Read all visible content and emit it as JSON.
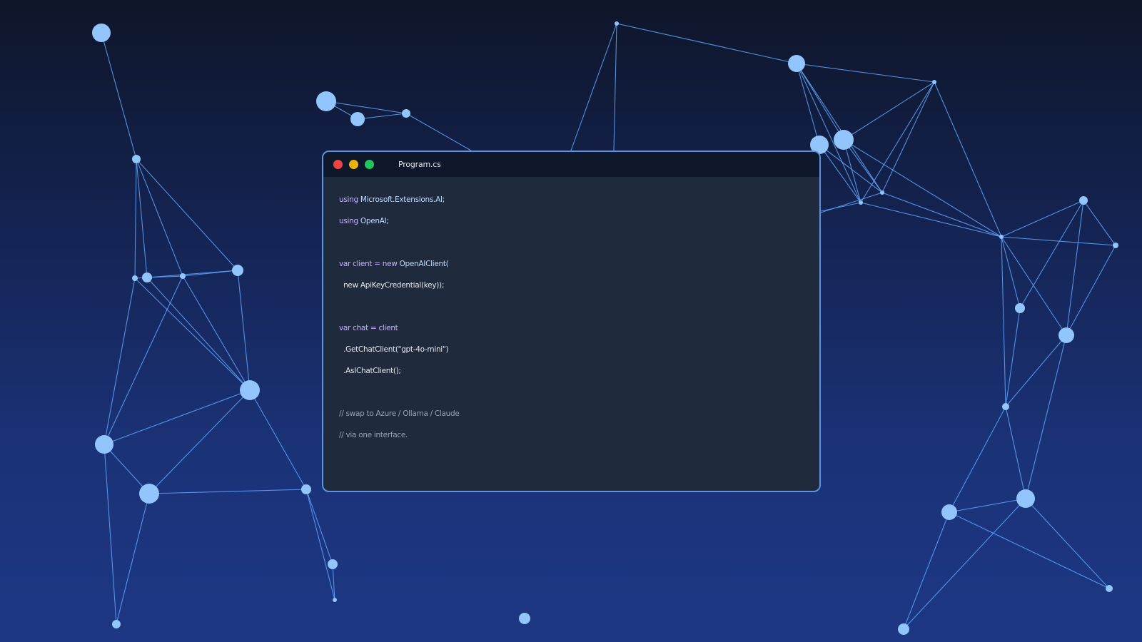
{
  "window": {
    "file_name": "Program.cs"
  },
  "code_lines": [
    [
      {
        "t": "using ",
        "c": "keyword"
      },
      {
        "t": "Microsoft.Extensions.AI;",
        "c": "type"
      }
    ],
    [
      {
        "t": "using ",
        "c": "keyword"
      },
      {
        "t": "OpenAI;",
        "c": "type"
      }
    ],
    [],
    [
      {
        "t": "var ",
        "c": "keyword"
      },
      {
        "t": "client = new ",
        "c": "keyword"
      },
      {
        "t": "OpenAIClient(",
        "c": "type"
      }
    ],
    [
      {
        "t": "  new ApiKeyCredential(key));",
        "c": "plain"
      }
    ],
    [],
    [
      {
        "t": "var ",
        "c": "keyword"
      },
      {
        "t": "chat = client",
        "c": "keyword"
      }
    ],
    [
      {
        "t": "  .GetChatClient(\"gpt-4o-mini\")",
        "c": "plain"
      }
    ],
    [
      {
        "t": "  .AsIChatClient();",
        "c": "plain"
      }
    ],
    [],
    [
      {
        "t": "// swap to Azure / Ollama / Claude",
        "c": "comment"
      }
    ],
    [
      {
        "t": "// via one interface.",
        "c": "comment"
      }
    ]
  ],
  "colors": {
    "node": "#93c5fd",
    "edge": "#60a5fa",
    "window_border": "#5d94e0",
    "close": "#ef4444",
    "minimize": "#eab308",
    "maximize": "#22c55e"
  }
}
